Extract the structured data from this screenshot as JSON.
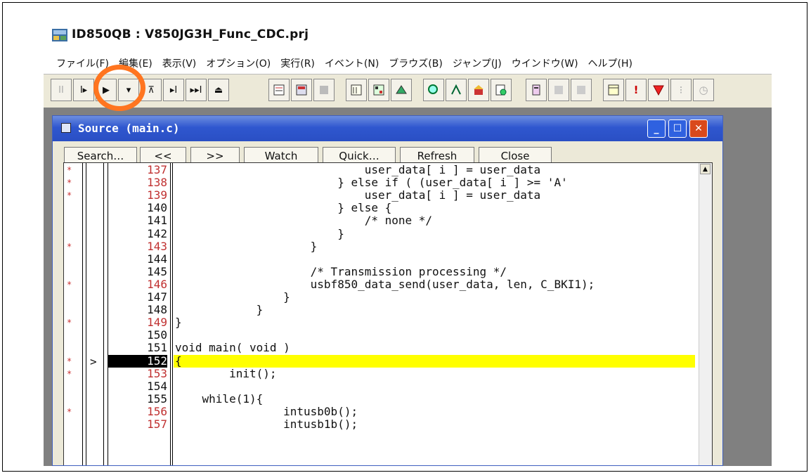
{
  "app": {
    "title": "ID850QB : V850JG3H_Func_CDC.prj"
  },
  "menu": [
    {
      "label": "ファイル(F)"
    },
    {
      "label": "編集(E)"
    },
    {
      "label": "表示(V)"
    },
    {
      "label": "オプション(O)"
    },
    {
      "label": "実行(R)"
    },
    {
      "label": "イベント(N)"
    },
    {
      "label": "ブラウズ(B)"
    },
    {
      "label": "ジャンプ(J)"
    },
    {
      "label": "ウインドウ(W)"
    },
    {
      "label": "ヘルプ(H)"
    }
  ],
  "toolbar": {
    "run_group": [
      {
        "name": "stop-icon",
        "glyph": "II",
        "disabled": true
      },
      {
        "name": "restart-icon",
        "glyph": "I▸",
        "disabled": false
      },
      {
        "name": "go-icon",
        "glyph": "▶",
        "disabled": false
      },
      {
        "name": "step-in-icon",
        "glyph": "▾",
        "disabled": false
      },
      {
        "name": "step-over-icon",
        "glyph": "⊼",
        "disabled": false
      },
      {
        "name": "return-out-icon",
        "glyph": "▸I",
        "disabled": false
      },
      {
        "name": "step-run-icon",
        "glyph": "▸▸I",
        "disabled": false
      },
      {
        "name": "reset-icon",
        "glyph": "⏏",
        "disabled": false
      }
    ],
    "highlighted_button": "go-button"
  },
  "source_window": {
    "title": "Source (main.c)",
    "buttons": {
      "search": "Search…",
      "back": "<<",
      "forward": ">>",
      "watch": "Watch",
      "quick": "Quick…",
      "refresh": "Refresh",
      "close": "Close"
    },
    "lines": [
      {
        "num": "137",
        "code": "                            user_data[ i ] = user_data",
        "bp": true,
        "red": true
      },
      {
        "num": "138",
        "code": "                        } else if ( (user_data[ i ] >= 'A'",
        "bp": true,
        "red": true
      },
      {
        "num": "139",
        "code": "                            user_data[ i ] = user_data",
        "bp": true,
        "red": true
      },
      {
        "num": "140",
        "code": "                        } else {",
        "bp": false,
        "red": false
      },
      {
        "num": "141",
        "code": "                            /* none */",
        "bp": false,
        "red": false
      },
      {
        "num": "142",
        "code": "                        }",
        "bp": false,
        "red": false
      },
      {
        "num": "143",
        "code": "                    }",
        "bp": true,
        "red": true
      },
      {
        "num": "144",
        "code": "",
        "bp": false,
        "red": false
      },
      {
        "num": "145",
        "code": "                    /* Transmission processing */",
        "bp": false,
        "red": false
      },
      {
        "num": "146",
        "code": "                    usbf850_data_send(user_data, len, C_BKI1);",
        "bp": true,
        "red": true
      },
      {
        "num": "147",
        "code": "                }",
        "bp": false,
        "red": false
      },
      {
        "num": "148",
        "code": "            }",
        "bp": false,
        "red": false
      },
      {
        "num": "149",
        "code": "}",
        "bp": true,
        "red": true
      },
      {
        "num": "150",
        "code": "",
        "bp": false,
        "red": false
      },
      {
        "num": "151",
        "code": "void main( void )",
        "bp": false,
        "red": false
      },
      {
        "num": "152",
        "code": "{",
        "bp": true,
        "red": false,
        "current": true
      },
      {
        "num": "153",
        "code": "        init();",
        "bp": true,
        "red": true
      },
      {
        "num": "154",
        "code": "",
        "bp": false,
        "red": false
      },
      {
        "num": "155",
        "code": "    while(1){",
        "bp": false,
        "red": false
      },
      {
        "num": "156",
        "code": "                intusb0b();",
        "bp": true,
        "red": true
      },
      {
        "num": "157",
        "code": "                intusb1b();",
        "bp": false,
        "red": true
      }
    ],
    "current_marker": ">"
  }
}
